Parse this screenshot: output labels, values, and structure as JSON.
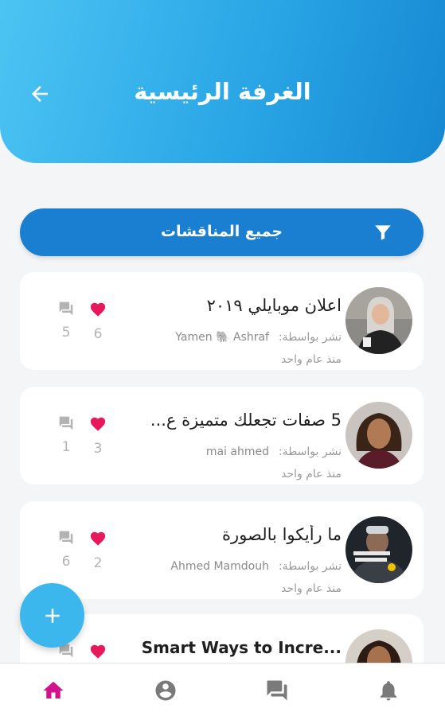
{
  "header": {
    "title": "الغرفة الرئيسية",
    "back_icon": "arrow-left-icon"
  },
  "filter": {
    "label": "جميع المناقشات",
    "icon": "filter-icon"
  },
  "posts": [
    {
      "title": "اعلان موبايلي ٢٠١٩",
      "posted_by_label": "نشر بواسطة:",
      "author": "Yamen 🐘 Ashraf",
      "time": "منذ عام واحد",
      "likes": "6",
      "comments": "5"
    },
    {
      "title": "5 صفات تجعلك متميزة ع...",
      "posted_by_label": "نشر بواسطة:",
      "author": "mai ahmed",
      "time": "منذ عام واحد",
      "likes": "3",
      "comments": "1"
    },
    {
      "title": "ما رأيكوا بالصورة",
      "posted_by_label": "نشر بواسطة:",
      "author": "Ahmed Mamdouh",
      "time": "منذ عام واحد",
      "likes": "2",
      "comments": "6"
    },
    {
      "title": "Smart Ways to Incre..."
    }
  ],
  "colors": {
    "header_start": "#4cc4f3",
    "header_end": "#1688d2",
    "filter_bar": "#1a7fd0",
    "like": "#e8195a",
    "nav_active": "#d1128c",
    "fab": "#3bb7ee"
  },
  "nav": {
    "items": [
      "home-icon",
      "profile-icon",
      "chat-icon",
      "bell-icon"
    ],
    "active": "home-icon"
  }
}
